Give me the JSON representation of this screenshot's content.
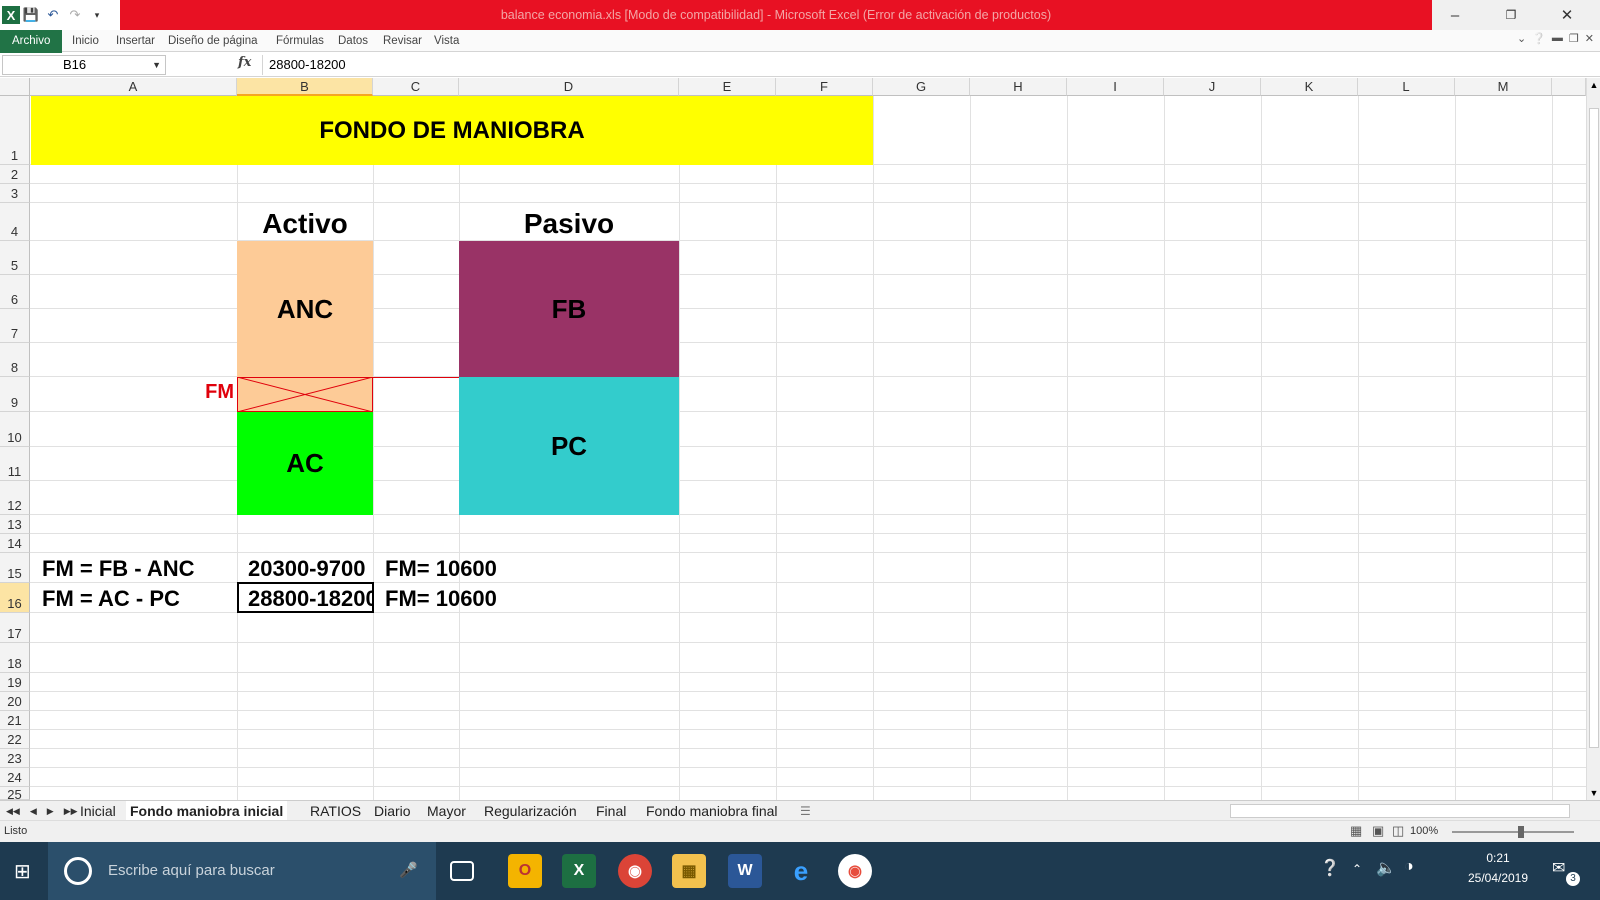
{
  "window": {
    "title": "balance economia.xls  [Modo de compatibilidad] - Microsoft Excel (Error de activación de productos)"
  },
  "ribbon": {
    "file_tab": "Archivo",
    "tabs": [
      "Inicio",
      "Insertar",
      "Diseño de página",
      "Fórmulas",
      "Datos",
      "Revisar",
      "Vista"
    ]
  },
  "formula_bar": {
    "name_box": "B16",
    "fx_label": "fx",
    "content": "28800-18200"
  },
  "columns": [
    "A",
    "B",
    "C",
    "D",
    "E",
    "F",
    "G",
    "H",
    "I",
    "J",
    "K",
    "L",
    "M"
  ],
  "selected_column": "B",
  "rows": [
    "1",
    "2",
    "3",
    "4",
    "5",
    "6",
    "7",
    "8",
    "9",
    "10",
    "11",
    "12",
    "13",
    "14",
    "15",
    "16",
    "17",
    "18",
    "19",
    "20",
    "21",
    "22",
    "23",
    "24",
    "25"
  ],
  "selected_row": "16",
  "sheet": {
    "title": "FONDO DE MANIOBRA",
    "activo_label": "Activo",
    "pasivo_label": "Pasivo",
    "anc": "ANC",
    "ac": "AC",
    "fb": "FB",
    "pc": "PC",
    "fm_label": "FM",
    "row15_a": "FM = FB - ANC",
    "row15_b": "20300-9700",
    "row15_c": "FM= 10600",
    "row16_a": "FM = AC - PC",
    "row16_b": "28800-18200",
    "row16_c": "FM= 10600",
    "colors": {
      "title_bg": "#ffff00",
      "anc_bg": "#fdcb97",
      "ac_bg": "#00ff00",
      "fb_bg": "#993366",
      "pc_bg": "#33cccc",
      "fm_red": "#e0000b"
    }
  },
  "sheet_tabs": [
    "Inicial",
    "Fondo maniobra inicial",
    "RATIOS",
    "Diario",
    "Mayor",
    "Regularización",
    "Final",
    "Fondo maniobra final"
  ],
  "active_sheet_tab": "Fondo maniobra inicial",
  "status": {
    "ready": "Listo",
    "zoom": "100%"
  },
  "taskbar": {
    "search_placeholder": "Escribe aquí para buscar",
    "time": "0:21",
    "date": "25/04/2019",
    "notification_count": "3"
  }
}
